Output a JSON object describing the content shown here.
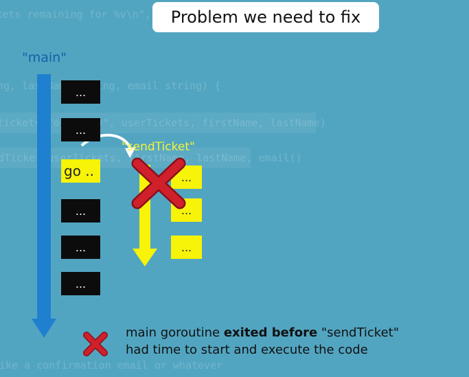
{
  "title": "Problem we need to fix",
  "main_label": "\"main\"",
  "send_label": "\"sendTicket\"",
  "main_blocks": [
    "...",
    "...",
    "go ..",
    "...",
    "...",
    "..."
  ],
  "send_blocks": [
    "...",
    "...",
    "..."
  ],
  "caption": {
    "line1_pre": "main goroutine ",
    "line1_bold": "exited before",
    "line1_post": " \"sendTicket\"",
    "line2": "had time to start and execute the code"
  },
  "background_code": [
    "%v tickets remaining for %v\\n\", remainingTickets, conferenceName)",
    "string, lastName string, email string) {",
    "\"%v tickets for %v %v\", userTickets, firstName, lastName)",
    "sendTicket(userTickets, firstName, lastName, email()",
    "like a confirmation email or whatever"
  ],
  "colors": {
    "background": "#52a5c1",
    "main_arrow": "#1f80d0",
    "send_arrow": "#f7f309",
    "cross": "#d0202c",
    "dark_block": "#0c0c0c",
    "yellow_block": "#f7f309"
  }
}
